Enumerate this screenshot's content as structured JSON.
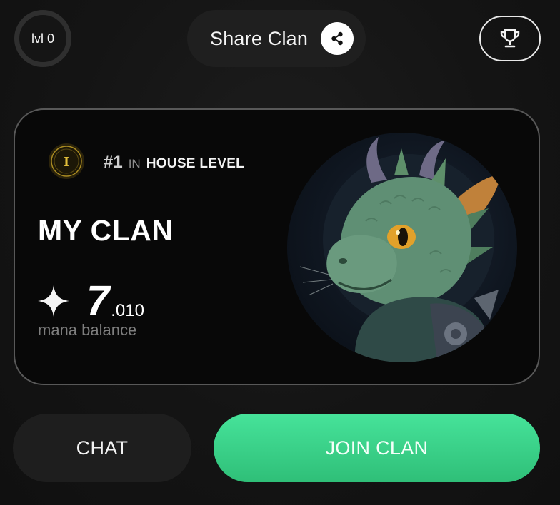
{
  "header": {
    "level_label": "lvl 0",
    "share_label": "Share Clan",
    "share_icon": "share-icon",
    "trophy_icon": "trophy-icon"
  },
  "card": {
    "rank_badge_letter": "I",
    "rank_number": "#1",
    "rank_in": "IN",
    "rank_category": "HOUSE LEVEL",
    "clan_name": "MY CLAN",
    "mana_integer": "7",
    "mana_decimal": ".010",
    "mana_label": "mana balance",
    "avatar_icon": "dragon-avatar"
  },
  "actions": {
    "chat_label": "CHAT",
    "join_label": "JOIN CLAN"
  },
  "colors": {
    "background": "#121212",
    "card_border": "#585858",
    "accent_green": "#3fd68c",
    "badge_gold": "#c9a227"
  }
}
